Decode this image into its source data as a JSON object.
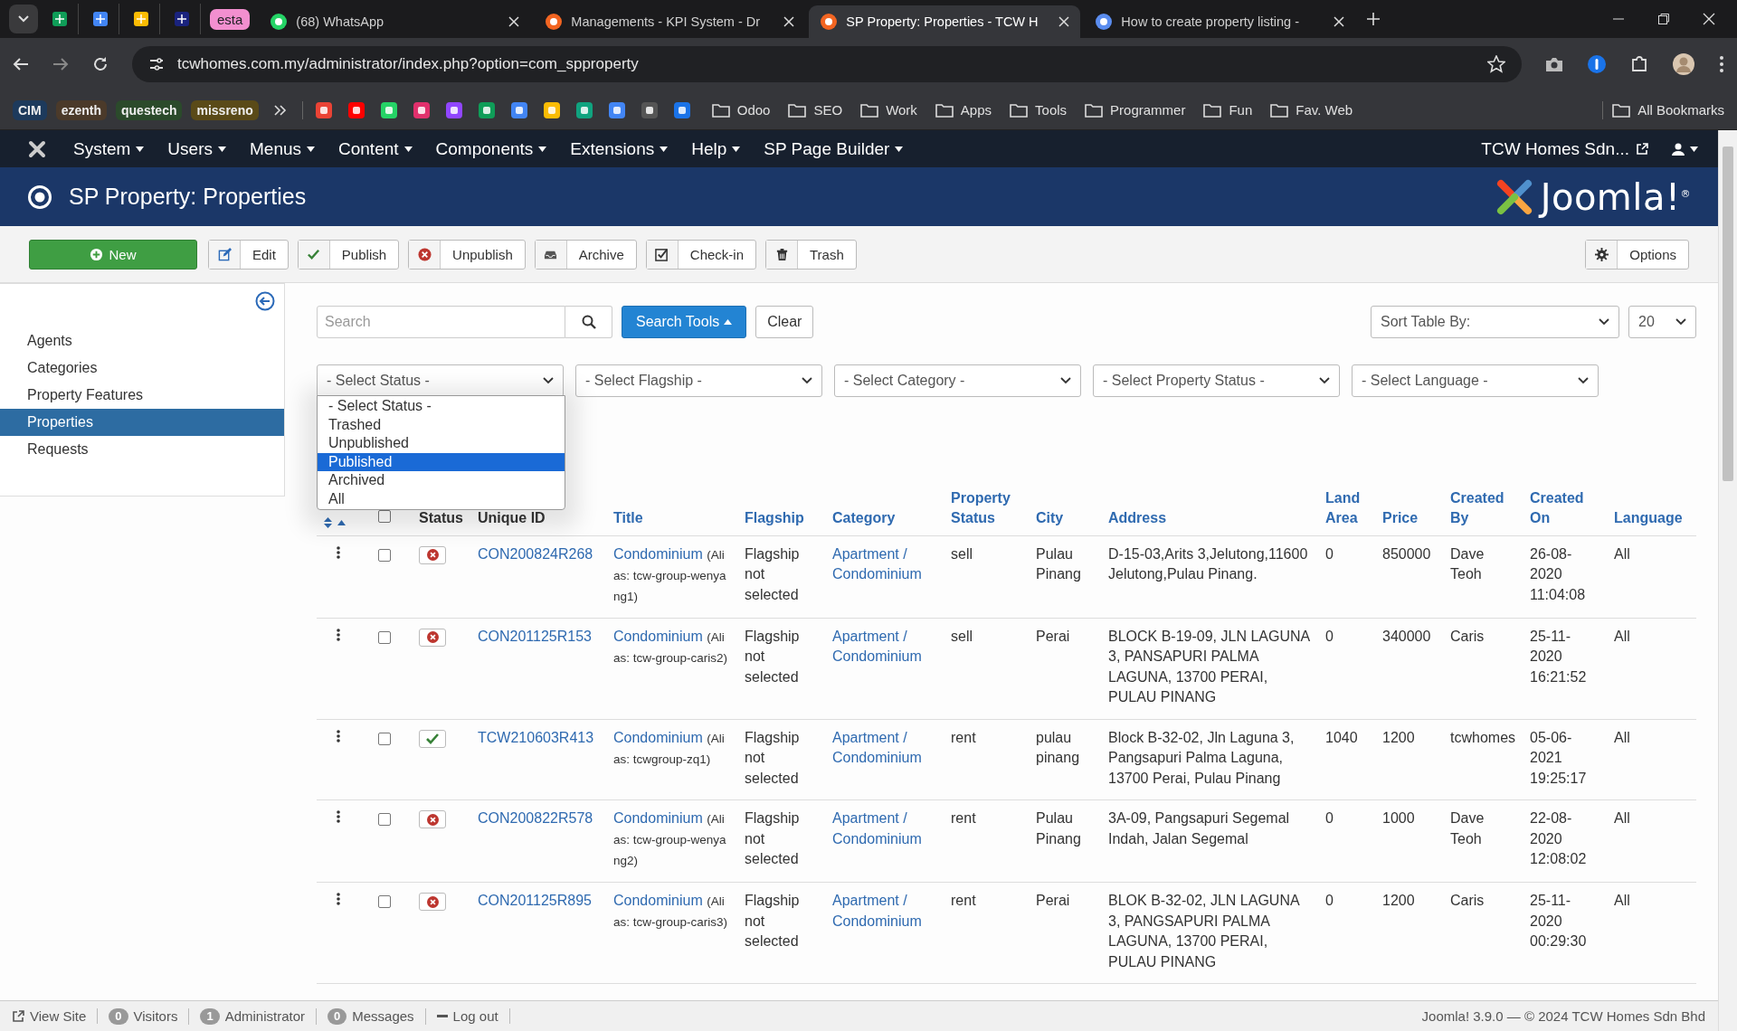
{
  "browser": {
    "tab_group": {
      "label": "esta"
    },
    "tabs": [
      {
        "label": "(68) WhatsApp",
        "selected": false
      },
      {
        "label": "Managements - KPI System - Dr",
        "selected": false
      },
      {
        "label": "SP Property: Properties - TCW H",
        "selected": true
      },
      {
        "label": "How to create property listing -",
        "selected": false
      }
    ],
    "address_bar": {
      "url": "tcwhomes.com.my/administrator/index.php?option=com_spproperty"
    },
    "bookmark_groups": [
      {
        "label": "CIM",
        "color": "#1d3a5c"
      },
      {
        "label": "ezenth",
        "color": "#4b3a2a"
      },
      {
        "label": "questech",
        "color": "#2b4a2b"
      },
      {
        "label": "missreno",
        "color": "#5a4a18"
      }
    ],
    "bookmark_folders": [
      "Odoo",
      "SEO",
      "Work",
      "Apps",
      "Tools",
      "Programmer",
      "Fun",
      "Fav. Web"
    ],
    "all_bookmarks": "All Bookmarks"
  },
  "admin_menu": {
    "items": [
      "System",
      "Users",
      "Menus",
      "Content",
      "Components",
      "Extensions",
      "Help",
      "SP Page Builder"
    ],
    "site_link": "TCW Homes Sdn..."
  },
  "header": {
    "title": "SP Property: Properties",
    "logo_text": "Joomla!$^{®}$"
  },
  "toolbar": {
    "buttons": [
      {
        "label": "New",
        "kind": "new"
      },
      {
        "label": "Edit",
        "kind": "edit"
      },
      {
        "label": "Publish",
        "kind": "publish"
      },
      {
        "label": "Unpublish",
        "kind": "unpublish"
      },
      {
        "label": "Archive",
        "kind": "archive"
      },
      {
        "label": "Check-in",
        "kind": "checkin"
      },
      {
        "label": "Trash",
        "kind": "trash"
      }
    ],
    "options": "Options"
  },
  "sidebar": {
    "items": [
      {
        "label": "Agents",
        "selected": false
      },
      {
        "label": "Categories",
        "selected": false
      },
      {
        "label": "Property Features",
        "selected": false
      },
      {
        "label": "Properties",
        "selected": true
      },
      {
        "label": "Requests",
        "selected": false
      }
    ]
  },
  "filters": {
    "search": {
      "placeholder": "Search"
    },
    "search_tools": "Search Tools",
    "clear": "Clear",
    "sort": "Sort Table By:",
    "limit": "20",
    "selects": [
      "- Select Status -",
      "- Select Flagship -",
      "- Select Category -",
      "- Select Property Status -",
      "- Select Language -"
    ],
    "status_options": [
      {
        "label": "- Select Status -",
        "selected": false
      },
      {
        "label": "Trashed",
        "selected": false
      },
      {
        "label": "Unpublished",
        "selected": false
      },
      {
        "label": "Published",
        "selected": true
      },
      {
        "label": "Archived",
        "selected": false
      },
      {
        "label": "All",
        "selected": false
      }
    ]
  },
  "table": {
    "select_all": {
      "checked": false
    },
    "columns": [
      {
        "label": "Status",
        "kind": "text"
      },
      {
        "label": "Unique ID",
        "kind": "text"
      },
      {
        "label": "Title",
        "kind": "link"
      },
      {
        "label": "Flagship",
        "kind": "link"
      },
      {
        "label": "Category",
        "kind": "link"
      },
      {
        "label": "Property Status",
        "kind": "link"
      },
      {
        "label": "City",
        "kind": "link"
      },
      {
        "label": "Address",
        "kind": "link"
      },
      {
        "label": "Land Area",
        "kind": "link"
      },
      {
        "label": "Price",
        "kind": "link"
      },
      {
        "label": "Created By",
        "kind": "link"
      },
      {
        "label": "Created On",
        "kind": "link"
      },
      {
        "label": "Language",
        "kind": "link"
      }
    ],
    "rows": [
      {
        "checked": false,
        "published": false,
        "unique_id": "CON200824R268",
        "title": "Condominium",
        "alias": "(Alias: tcw-group-wenyang1)",
        "flagship": "Flagship not selected",
        "category": "Apartment / Condominium",
        "property_status": "sell",
        "city": "Pulau Pinang",
        "address": "D-15-03,Arits 3,Jelutong,11600 Jelutong,Pulau Pinang.",
        "land_area": "0",
        "price": "850000",
        "created_by": "Dave Teoh",
        "created_on": "26-08-2020 11:04:08",
        "language": "All"
      },
      {
        "checked": false,
        "published": false,
        "unique_id": "CON201125R153",
        "title": "Condominium",
        "alias": "(Alias: tcw-group-caris2)",
        "flagship": "Flagship not selected",
        "category": "Apartment / Condominium",
        "property_status": "sell",
        "city": "Perai",
        "address": "BLOCK B-19-09, JLN LAGUNA 3, PANSAPURI PALMA LAGUNA, 13700 PERAI, PULAU PINANG",
        "land_area": "0",
        "price": "340000",
        "created_by": "Caris",
        "created_on": "25-11-2020 16:21:52",
        "language": "All"
      },
      {
        "checked": false,
        "published": true,
        "unique_id": "TCW210603R413",
        "title": "Condominium",
        "alias": "(Alias: tcwgroup-zq1)",
        "flagship": "Flagship not selected",
        "category": "Apartment / Condominium",
        "property_status": "rent",
        "city": "pulau pinang",
        "address": "Block B-32-02, Jln Laguna 3, Pangsapuri Palma Laguna, 13700 Perai, Pulau Pinang",
        "land_area": "1040",
        "price": "1200",
        "created_by": "tcwhomes",
        "created_on": "05-06-2021 19:25:17",
        "language": "All"
      },
      {
        "checked": false,
        "published": false,
        "unique_id": "CON200822R578",
        "title": "Condominium",
        "alias": "(Alias: tcw-group-wenyang2)",
        "flagship": "Flagship not selected",
        "category": "Apartment / Condominium",
        "property_status": "rent",
        "city": "Pulau Pinang",
        "address": "3A-09, Pangsapuri Segemal Indah, Jalan Segemal",
        "land_area": "0",
        "price": "1000",
        "created_by": "Dave Teoh",
        "created_on": "22-08-2020 12:08:02",
        "language": "All"
      },
      {
        "checked": false,
        "published": false,
        "unique_id": "CON201125R895",
        "title": "Condominium",
        "alias": "(Alias: tcw-group-caris3)",
        "flagship": "Flagship not selected",
        "category": "Apartment / Condominium",
        "property_status": "rent",
        "city": "Perai",
        "address": "BLOK B-32-02, JLN LAGUNA 3, PANGSAPURI PALMA LAGUNA, 13700 PERAI, PULAU PINANG",
        "land_area": "0",
        "price": "1200",
        "created_by": "Caris",
        "created_on": "25-11-2020 00:29:30",
        "language": "All"
      }
    ]
  },
  "footer": {
    "items": [
      {
        "kind": "link",
        "label": "View Site"
      },
      {
        "kind": "count",
        "count": "0",
        "label": "Visitors"
      },
      {
        "kind": "count",
        "count": "1",
        "label": "Administrator"
      },
      {
        "kind": "count",
        "count": "0",
        "label": "Messages"
      },
      {
        "kind": "logout",
        "label": "Log out"
      }
    ],
    "copyright": "Joomla! 3.9.0 — © 2024 TCW Homes Sdn Bhd"
  }
}
